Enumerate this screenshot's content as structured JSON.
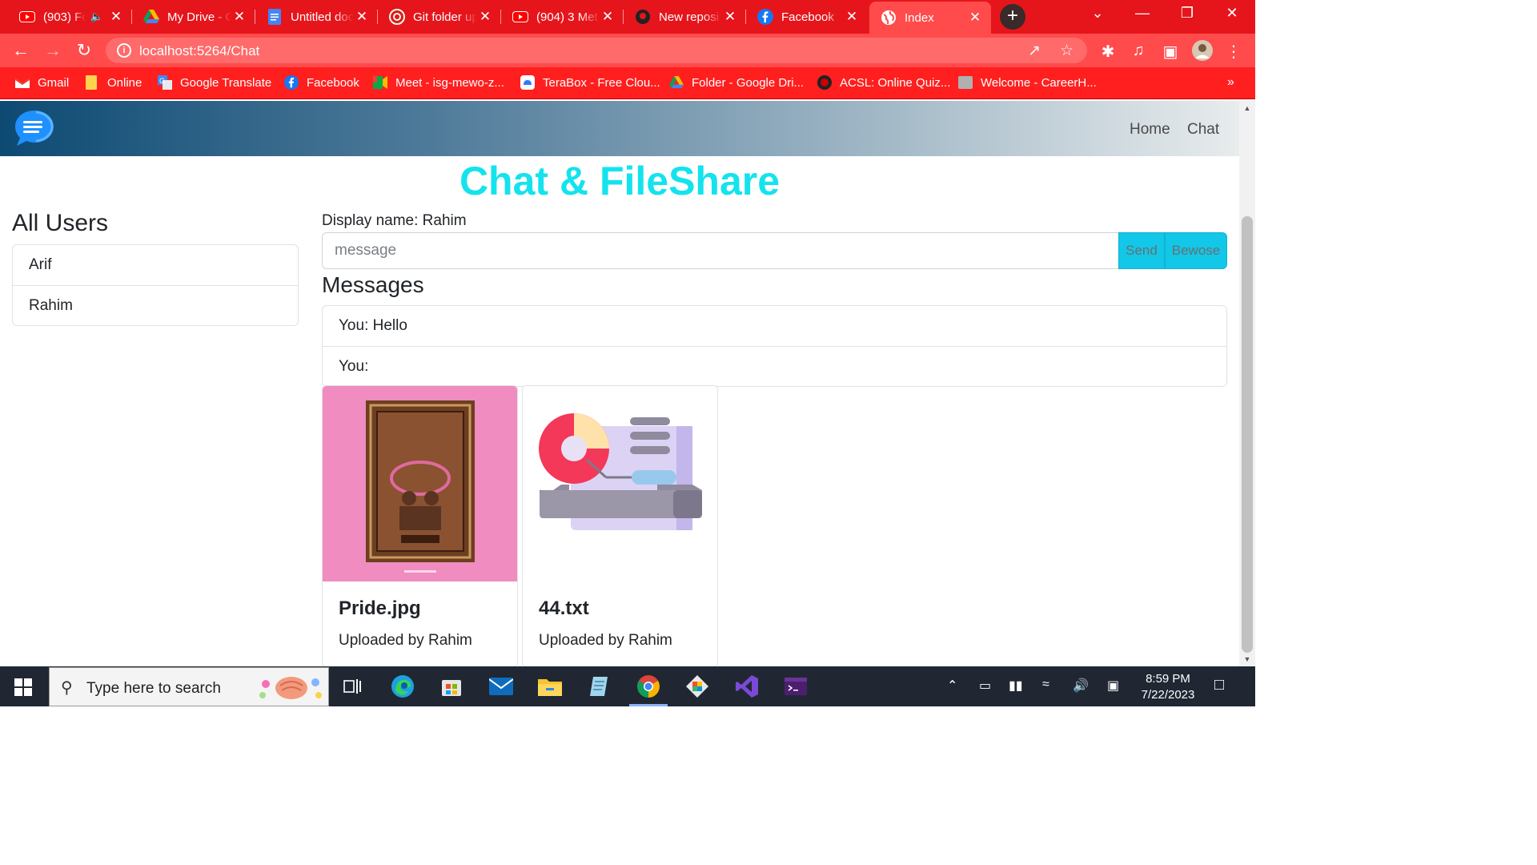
{
  "browser": {
    "tabs": [
      {
        "title": "(903) Fo",
        "icon": "youtube-icon"
      },
      {
        "title": "My Drive - G",
        "icon": "google-drive-icon"
      },
      {
        "title": "Untitled doc",
        "icon": "google-docs-icon"
      },
      {
        "title": "Git folder up",
        "icon": "chatgpt-icon"
      },
      {
        "title": "(904) 3 Met",
        "icon": "youtube-icon"
      },
      {
        "title": "New reposi",
        "icon": "github-icon"
      },
      {
        "title": "Facebook",
        "icon": "facebook-icon"
      },
      {
        "title": "Index",
        "icon": "globe-icon"
      }
    ],
    "address": "localhost:5264/Chat",
    "bookmarks": [
      {
        "label": "Gmail",
        "icon": "gmail-icon"
      },
      {
        "label": "Online",
        "icon": "folder-icon"
      },
      {
        "label": "Google Translate",
        "icon": "translate-icon"
      },
      {
        "label": "Facebook",
        "icon": "facebook-icon"
      },
      {
        "label": "Meet - isg-mewo-z...",
        "icon": "meet-icon"
      },
      {
        "label": "TeraBox - Free Clou...",
        "icon": "terabox-icon"
      },
      {
        "label": "Folder - Google Dri...",
        "icon": "google-drive-icon"
      },
      {
        "label": "ACSL: Online Quiz...",
        "icon": "acsl-icon"
      },
      {
        "label": "Welcome - CareerH...",
        "icon": "careerh-icon"
      }
    ]
  },
  "site": {
    "nav": {
      "home": "Home",
      "chat": "Chat"
    },
    "title": "Chat & FileShare",
    "users_heading": "All Users",
    "users": [
      "Arif",
      "Rahim"
    ],
    "display_name": "Display name: Rahim",
    "message_placeholder": "message",
    "send_label": "Send",
    "browse_label": "Bewose",
    "messages_heading": "Messages",
    "messages": [
      "You: Hello",
      "You:"
    ],
    "files": [
      {
        "name": "Pride.jpg",
        "uploaded_by": "Uploaded by Rahim",
        "thumb_bg": "#f08cc0"
      },
      {
        "name": "44.txt",
        "uploaded_by": "Uploaded by Rahim",
        "thumb_bg": "#ffffff"
      }
    ]
  },
  "taskbar": {
    "search_placeholder": "Type here to search",
    "time": "8:59 PM",
    "date": "7/22/2023"
  },
  "colors": {
    "browser_accent": "#ff4b4b",
    "title_cyan": "#14e3ee",
    "button_cyan": "#12c7e8"
  }
}
